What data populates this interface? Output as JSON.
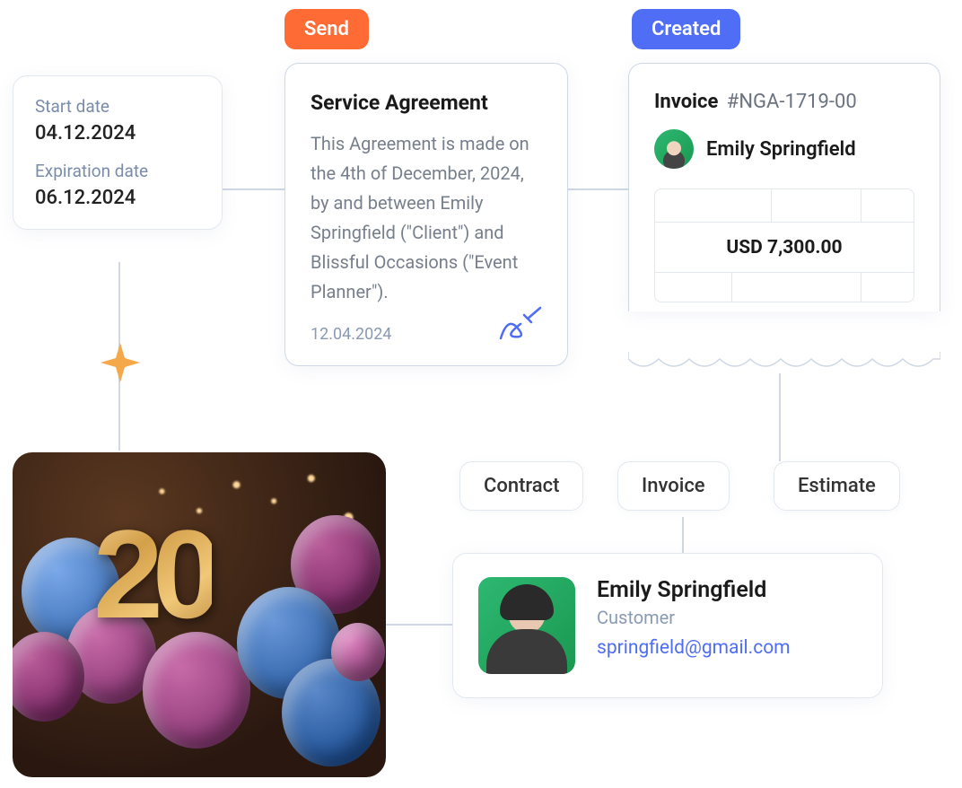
{
  "dates": {
    "start_label": "Start date",
    "start_value": "04.12.2024",
    "exp_label": "Expiration date",
    "exp_value": "06.12.2024"
  },
  "badges": {
    "send": "Send",
    "created": "Created"
  },
  "agreement": {
    "title": "Service Agreement",
    "body": "This Agreement is made on the 4th of December, 2024, by and between Emily Springfield (\"Client\") and Blissful Occasions (\"Event Planner\").",
    "date": "12.04.2024"
  },
  "invoice": {
    "label": "Invoice",
    "number": "#NGA-1719-00",
    "person": "Emily Springfield",
    "amount": "USD 7,300.00"
  },
  "pills": {
    "contract": "Contract",
    "invoice": "Invoice",
    "estimate": "Estimate"
  },
  "customer": {
    "name": "Emily Springfield",
    "role": "Customer",
    "email": "springfield@gmail.com"
  },
  "balloons": {
    "number": "20"
  }
}
